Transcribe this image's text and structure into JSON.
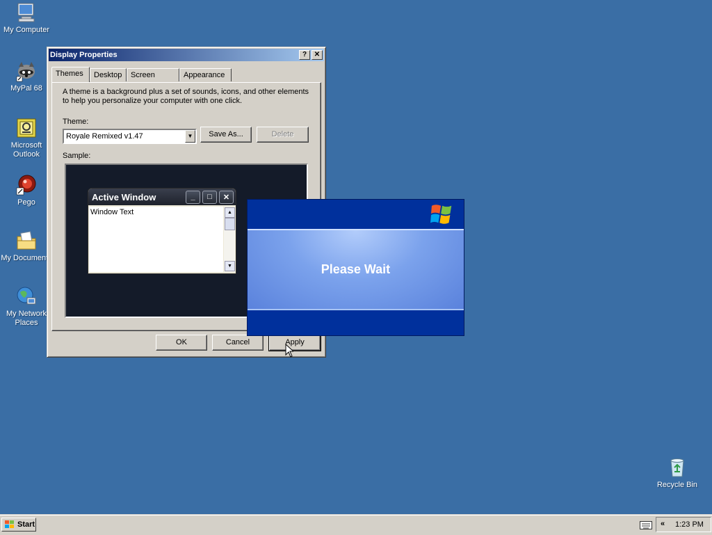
{
  "desktop": {
    "icons": [
      {
        "label": "My Computer",
        "icon": "my-computer-icon"
      },
      {
        "label": "MyPal 68",
        "icon": "mypal-icon"
      },
      {
        "label": "Microsoft Outlook",
        "icon": "outlook-icon"
      },
      {
        "label": "Pego",
        "icon": "pego-icon"
      },
      {
        "label": "My Documents",
        "icon": "my-documents-icon"
      },
      {
        "label": "My Network Places",
        "icon": "network-places-icon"
      },
      {
        "label": "Recycle Bin",
        "icon": "recycle-bin-icon"
      }
    ],
    "background_color": "#3a6ea5"
  },
  "display_properties": {
    "title": "Display Properties",
    "tabs": [
      {
        "label": "Themes",
        "active": true
      },
      {
        "label": "Desktop",
        "active": false
      },
      {
        "label": "Screen Saver",
        "active": false
      },
      {
        "label": "Appearance",
        "active": false
      }
    ],
    "description": "A theme is a background plus a set of sounds, icons, and other elements to help you personalize your computer with one click.",
    "theme_label": "Theme:",
    "theme_value": "Royale Remixed v1.47",
    "save_as_label": "Save As...",
    "delete_label": "Delete",
    "sample_label": "Sample:",
    "sample": {
      "active_window_title": "Active Window",
      "window_text": "Window Text"
    },
    "ok_label": "OK",
    "cancel_label": "Cancel",
    "apply_label": "Apply"
  },
  "please_wait": {
    "message": "Please Wait"
  },
  "taskbar": {
    "start_label": "Start",
    "clock": "1:23 PM",
    "expand_label": "«"
  }
}
